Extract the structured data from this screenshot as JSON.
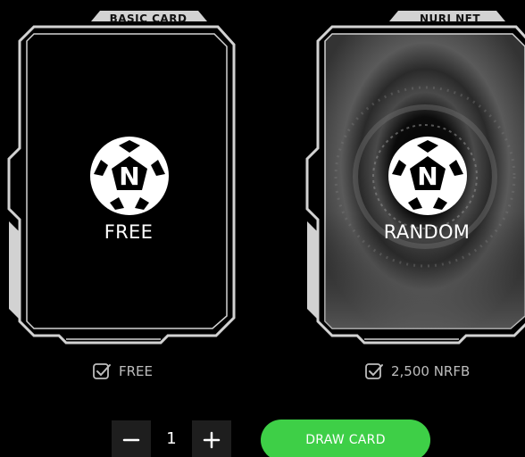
{
  "cards": [
    {
      "tab_label": "BASIC CARD",
      "logo_letter": "N",
      "title": "FREE",
      "price": "FREE",
      "price_icon": "check-square-icon"
    },
    {
      "tab_label": "NURI NFT",
      "logo_letter": "N",
      "title": "RANDOM",
      "price": "2,500 NRFB",
      "price_icon": "check-square-icon"
    }
  ],
  "quantity": {
    "value": "1",
    "minus_icon": "minus-icon",
    "plus_icon": "plus-icon"
  },
  "draw_button": {
    "label": "DRAW CARD"
  },
  "colors": {
    "background": "#000000",
    "card_frame": "#d2d2d2",
    "accent_green": "#3ecf47",
    "muted_text": "#bdbdbd",
    "stepper_bg": "#1e1e1e"
  }
}
